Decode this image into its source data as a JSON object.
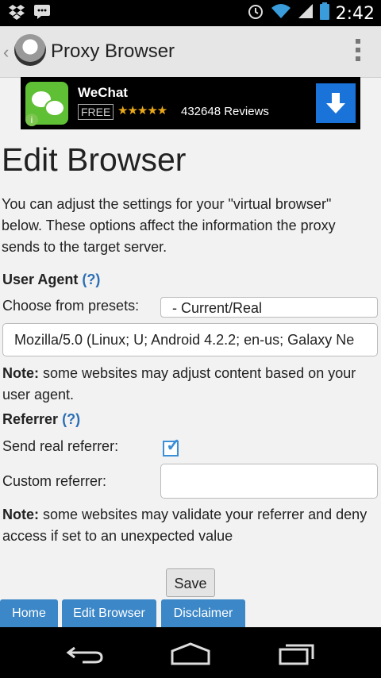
{
  "status_bar": {
    "left_icons": [
      "dropbox-icon",
      "bbm-icon"
    ],
    "right_icons": [
      "alarm-icon",
      "wifi-icon",
      "signal-icon",
      "battery-icon"
    ],
    "time": "2:42"
  },
  "action_bar": {
    "title": "Proxy Browser"
  },
  "ad": {
    "app_name": "WeChat",
    "price": "FREE",
    "rating_stars": "★★★★★",
    "rating": 4.5,
    "reviews": "432648 Reviews"
  },
  "page": {
    "heading": "Edit Browser",
    "intro": "You can adjust the settings for your \"virtual browser\" below. These options affect the information the proxy sends to the target server."
  },
  "user_agent": {
    "label": "User Agent",
    "help_open": "(",
    "help_q": "?",
    "help_close": ")",
    "presets_label": "Choose from presets:",
    "presets_value": "- Current/Real",
    "value": "Mozilla/5.0 (Linux; U; Android 4.2.2; en-us; Galaxy Ne",
    "note_bold": "Note:",
    "note_text": " some websites may adjust content based on your user agent."
  },
  "referrer": {
    "label": "Referrer",
    "help_open": "(",
    "help_q": "?",
    "help_close": ")",
    "send_real_label": "Send real referrer:",
    "send_real_checked": true,
    "custom_label": "Custom referrer:",
    "custom_value": "",
    "note_bold": "Note:",
    "note_text": " some websites may validate your referrer and deny access if set to an unexpected value"
  },
  "save_label": "Save",
  "bottom_links": [
    "Home",
    "Edit Browser",
    "Disclaimer"
  ],
  "colors": {
    "accent": "#3b87c8",
    "link": "#2b6fb5",
    "background": "#f2f2f2"
  }
}
